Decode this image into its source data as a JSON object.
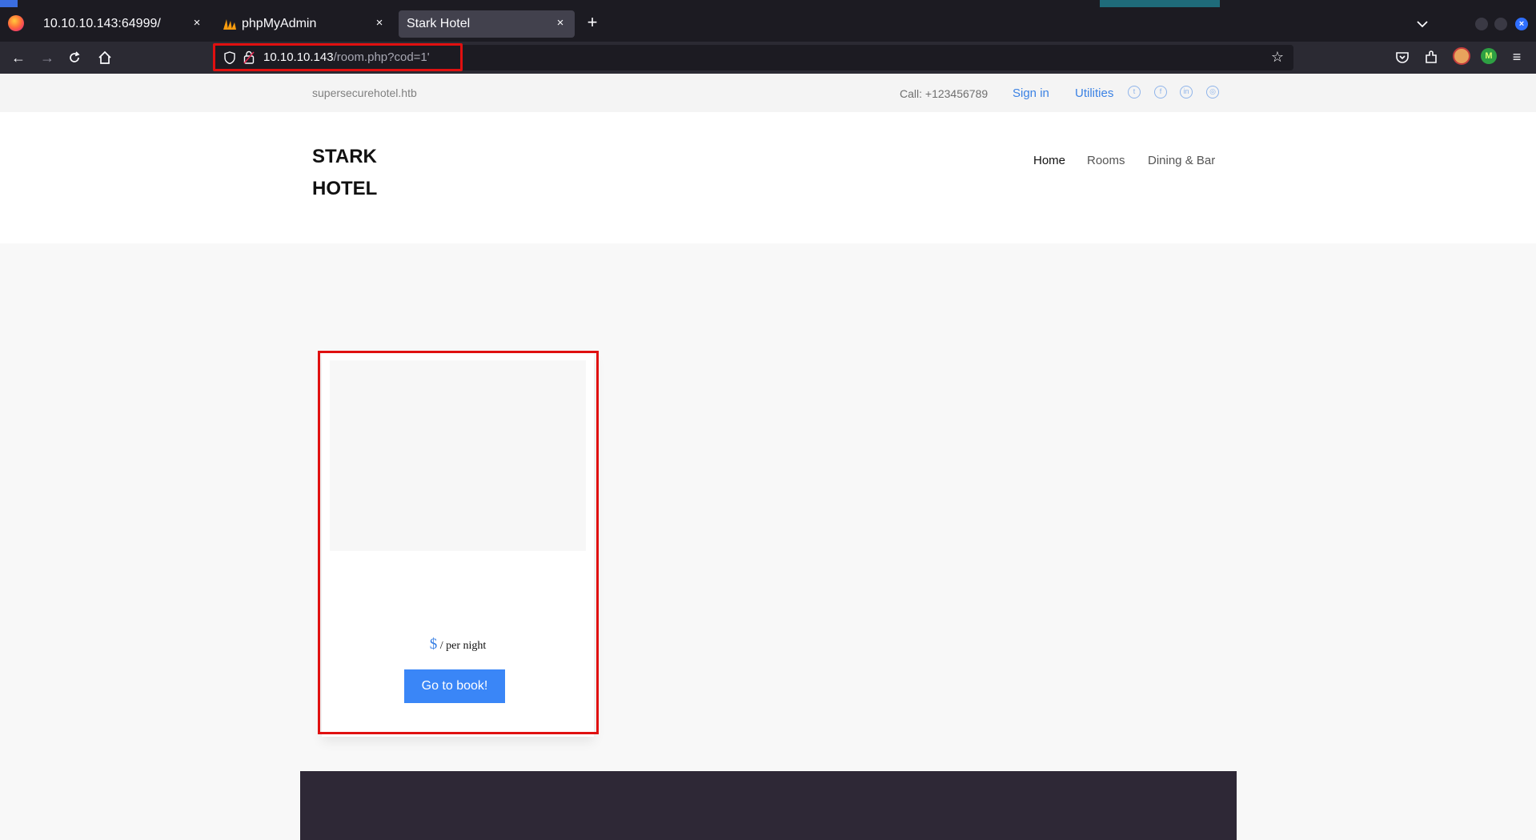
{
  "browser": {
    "tabs": [
      {
        "title": "10.10.10.143:64999/",
        "close": "×"
      },
      {
        "title": "phpMyAdmin",
        "close": "×"
      },
      {
        "title": "Stark Hotel",
        "close": "×"
      }
    ],
    "new_tab": "+",
    "url": {
      "host": "10.10.10.143",
      "path": "/room.php?cod=1'"
    },
    "colors": {
      "highlight": "#e01010",
      "chrome_dark": "#1c1b22",
      "toolbar": "#2b2a33"
    }
  },
  "site": {
    "domain": "supersecurehotel.htb",
    "call": "Call: +123456789",
    "sign_in": "Sign in",
    "utilities": "Utilities",
    "social_icons": [
      "twitter-icon",
      "facebook-icon",
      "linkedin-icon",
      "dribbble-icon"
    ],
    "brand": {
      "line1": "STARK",
      "line2": "HOTEL"
    },
    "menu": [
      "Home",
      "Rooms",
      "Dining & Bar"
    ],
    "room": {
      "currency": "$",
      "per_night": "/ per night",
      "book_label": "Go to book!"
    },
    "colors": {
      "accent": "#3b82e4",
      "button": "#3a86f7",
      "footer": "#2e2836"
    }
  }
}
